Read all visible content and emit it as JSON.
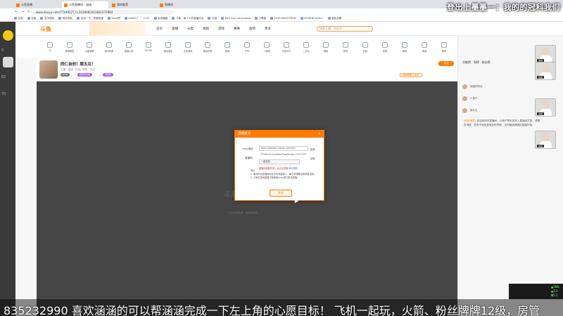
{
  "browser": {
    "tabs": [
      {
        "label": "斗鱼直播",
        "active": false
      },
      {
        "label": "斗鱼直播间 - 涵涵",
        "active": true
      },
      {
        "label": "我的推荐",
        "active": false
      },
      {
        "label": "直播间",
        "active": false
      }
    ],
    "url": "www.douyu.com/7744912?_f=2030065013831072964",
    "bookmarks": [
      "应用",
      "百度",
      "百中国标",
      "网站导航",
      "应用一下，你就知道",
      "DotA吧",
      "bilibili (゜-゜)つロ",
      "全球播报",
      "斗鱼 - 每个人的直播平台",
      "抖音",
      "Bad Guy Launchpad",
      "小黑盒",
      "LEVEL8&EXTRON",
      "LEVEL8Cards-C",
      "隐私设置"
    ]
  },
  "overlay": {
    "top_title": "登出上墨墨一：我的的冠科我们"
  },
  "leftbar": {
    "labels": [
      "0",
      "02",
      "70"
    ]
  },
  "site": {
    "logo": "斗鱼",
    "nav": [
      "首页",
      "直播",
      "分类",
      "视频",
      "游戏",
      "赛事",
      "鱼吧",
      "更多"
    ],
    "search_placeholder": "搜索主播、房间号",
    "categories": [
      "12",
      "英雄联盟",
      "王者荣耀",
      "和平精英",
      "穿越火线",
      "DOTA2",
      "绝地求生",
      "主机游戏",
      "魔兽世界",
      "颜值",
      "户外",
      "一起看",
      "手游大厅",
      "二次元",
      "音频",
      "体育",
      "科技",
      "赛事",
      "数码",
      "美食",
      "更多"
    ]
  },
  "room": {
    "title": "同仁自创！周五见！",
    "meta": "主播：涵涵 · 分类：颜值 · 关注",
    "badges": [
      {
        "label": "LV12",
        "color": "#7a7a7a"
      },
      {
        "label": "超级粉丝团",
        "color": "#a45cf0"
      },
      {
        "label": "周星榜",
        "color": "#a45cf0"
      }
    ],
    "follow_label": "关注",
    "report_label": "房间举报 | 关注"
  },
  "player": {
    "logo": "斗鱼",
    "tip": "正在加载直播，请稍候刷新"
  },
  "rightpanel": {
    "rank_title": "贡献榜 · 周榜 · 粉丝榜",
    "ranks": [
      "涵涵的粉丝",
      "小鱼干",
      "鱼丸王"
    ],
    "chat_prefix": "[系统消息]",
    "chat_text": "欢迎来到本直播间，斗鱼严禁未成年人直播或打赏，请理性消费，如有不良信息请及时举报，共同营造健康的直播环境。"
  },
  "cams": [
    "涵涵",
    "涵涵",
    "涵涵",
    "涵涵"
  ],
  "dialog": {
    "title": "直播推流",
    "rtmp_label": "rtmp地址：",
    "rtmp_value": "rtmp://sendtc3.douyu.com/live",
    "key_label": "直播码：",
    "key_value": "7744912rUuuEKAcf?wsSecret=**********",
    "copy_label": "复制",
    "select_value": "一键复制",
    "error_text": "直播码获取失败，请点击重新",
    "help_text": "申请帮助",
    "tips": [
      "提示：",
      "1. 推流码及直播间地址请勿泄露他人，每次重播都会刷新推流码。",
      "2. 只有在游戏直播才能使用rtmp进行推流直播。"
    ],
    "confirm_label": "关闭"
  },
  "ticker": {
    "text": "835232990 喜欢涵涵的可以帮涵涵完成一下左上角的心愿目标！ 飞机一起玩，火箭、粉丝牌牌12级，房管"
  },
  "stats": {
    "lines": [
      "▲5Mb",
      "▲3.1",
      "▼2.1"
    ]
  }
}
